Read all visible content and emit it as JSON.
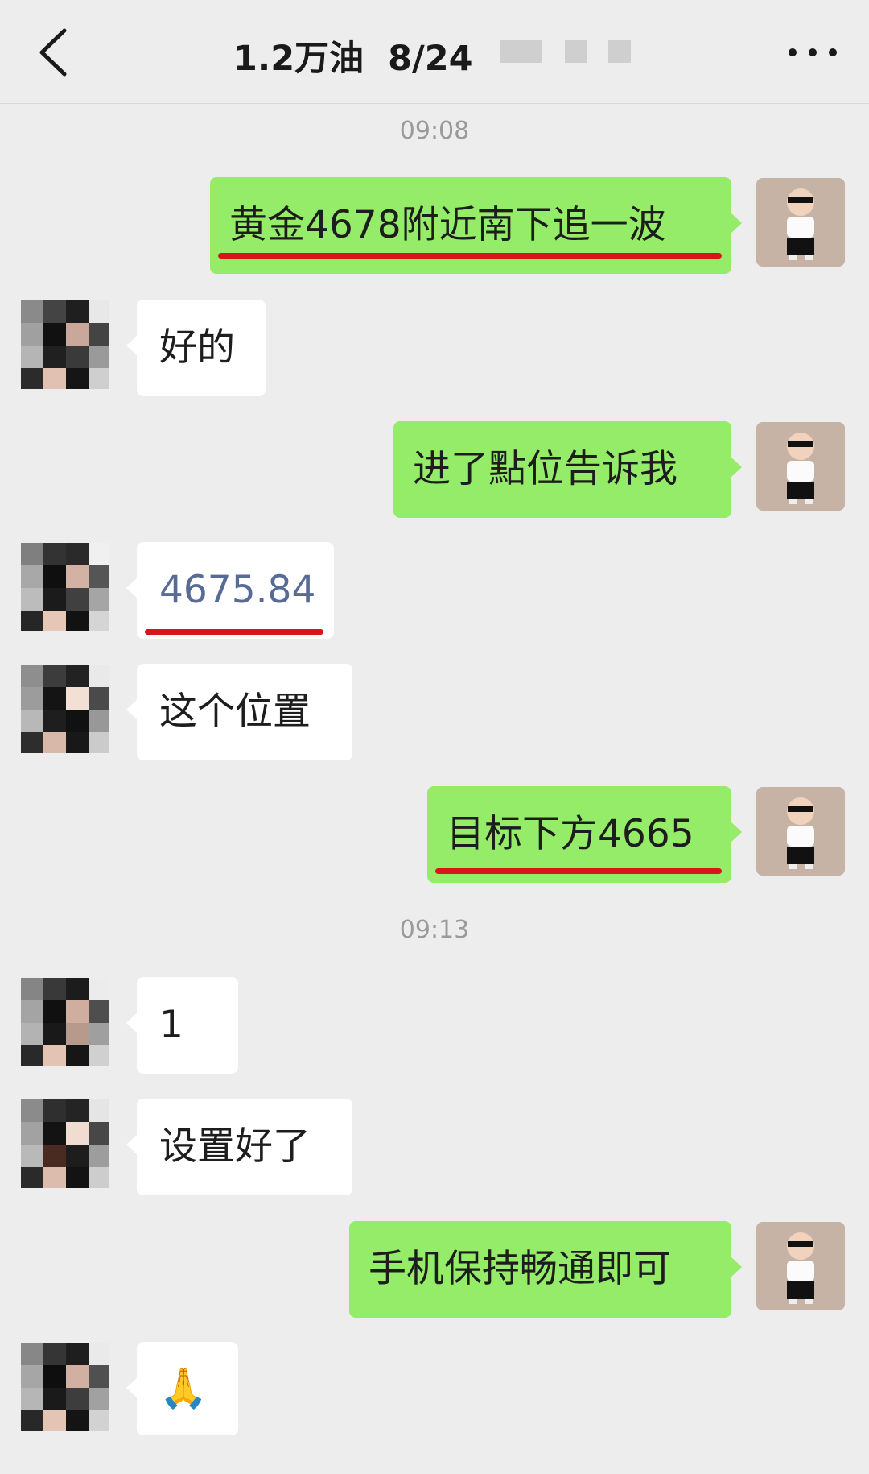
{
  "header": {
    "title": "1.2万油  8/24",
    "back_icon": "chevron-left-icon",
    "more_icon": "more-dots-icon"
  },
  "messages": [
    {
      "type": "time",
      "text": "09:08"
    },
    {
      "type": "msg",
      "from": "me",
      "text": "黄金4678附近南下追一波",
      "underlined": true
    },
    {
      "type": "msg",
      "from": "them",
      "text": "好的"
    },
    {
      "type": "msg",
      "from": "me",
      "text": "进了點位告诉我"
    },
    {
      "type": "msg",
      "from": "them",
      "text": "4675.84",
      "underlined": true,
      "color": "#576b95"
    },
    {
      "type": "msg",
      "from": "them",
      "text": "这个位置"
    },
    {
      "type": "msg",
      "from": "me",
      "text": "目标下方4665",
      "underlined": true
    },
    {
      "type": "time",
      "text": "09:13"
    },
    {
      "type": "msg",
      "from": "them",
      "text": "1"
    },
    {
      "type": "msg",
      "from": "them",
      "text": "设置好了"
    },
    {
      "type": "msg",
      "from": "me",
      "text": "手机保持畅通即可"
    },
    {
      "type": "msg",
      "from": "them",
      "text": "🙏",
      "emoji": true
    }
  ],
  "colors": {
    "me_bubble": "#95ec69",
    "them_bubble": "#ffffff",
    "underline": "#d8161a",
    "link_text": "#576b95",
    "background": "#ededed"
  }
}
